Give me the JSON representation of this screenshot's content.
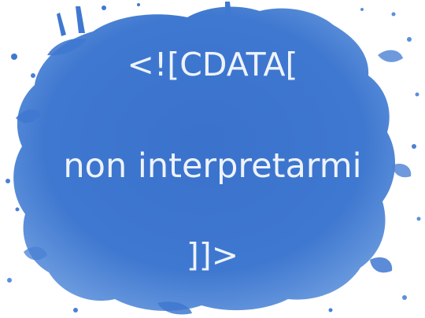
{
  "slide": {
    "line_open": "<![CDATA[",
    "line_middle": "non interpretarmi",
    "line_close": "]]>"
  },
  "colors": {
    "background": "#ffffff",
    "splash_blue": "#3f78d0",
    "splash_blue_light": "#5b8fdc",
    "text": "#eef3fb"
  }
}
